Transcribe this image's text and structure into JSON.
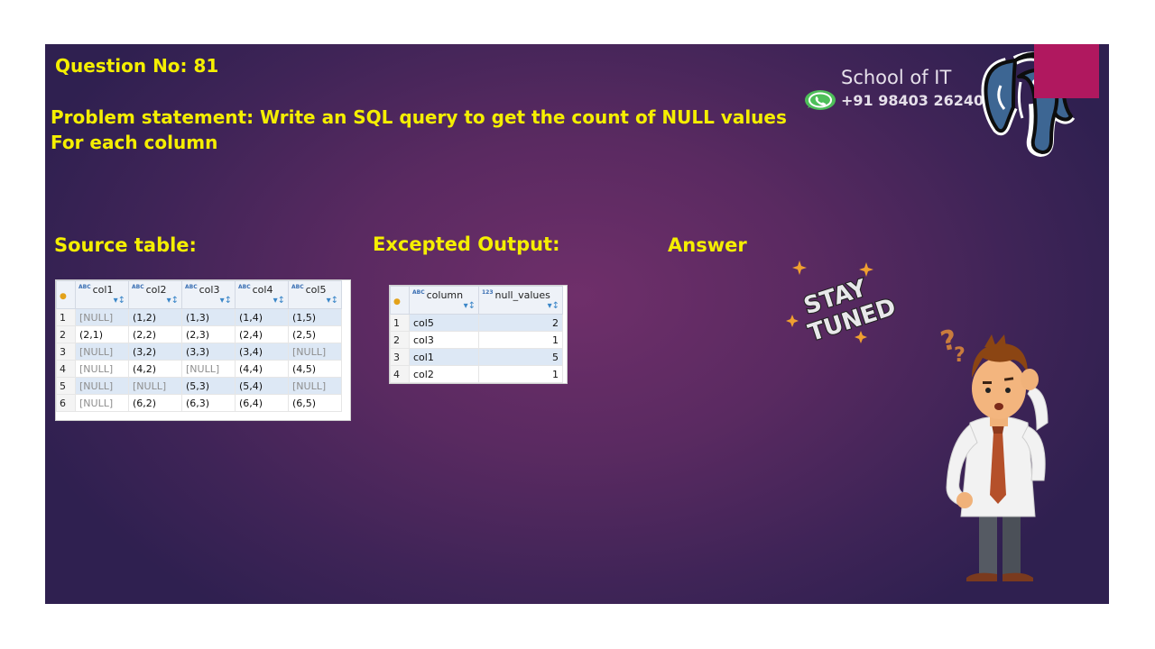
{
  "slide": {
    "question": "Question No: 81",
    "problem_line1": "Problem statement:  Write an SQL query to get the count of NULL values",
    "problem_line2": "For each column",
    "source_label": "Source table:",
    "output_label": "Excepted Output:",
    "answer_label": "Answer",
    "brand": "School of IT",
    "phone": "+91 98403 26240",
    "sticker_text": "STAY TUNED"
  },
  "colors": {
    "accent_yellow": "#f5ef00",
    "ribbon": "#b0185f",
    "bg": "#5a2a61"
  },
  "icons": [
    "whatsapp-icon",
    "postgresql-elephant-logo",
    "stay-tuned-sticker",
    "confused-man-illustration"
  ],
  "source_table": {
    "columns": [
      "col1",
      "col2",
      "col3",
      "col4",
      "col5"
    ],
    "type_tag": "ABC",
    "rows": [
      [
        "1",
        "[NULL]",
        "(1,2)",
        "(1,3)",
        "(1,4)",
        "(1,5)"
      ],
      [
        "2",
        "(2,1)",
        "(2,2)",
        "(2,3)",
        "(2,4)",
        "(2,5)"
      ],
      [
        "3",
        "[NULL]",
        "(3,2)",
        "(3,3)",
        "(3,4)",
        "[NULL]"
      ],
      [
        "4",
        "[NULL]",
        "(4,2)",
        "[NULL]",
        "(4,4)",
        "(4,5)"
      ],
      [
        "5",
        "[NULL]",
        "[NULL]",
        "(5,3)",
        "(5,4)",
        "[NULL]"
      ],
      [
        "6",
        "[NULL]",
        "(6,2)",
        "(6,3)",
        "(6,4)",
        "(6,5)"
      ]
    ]
  },
  "output_table": {
    "columns": [
      "column",
      "null_values"
    ],
    "type_tags": [
      "ABC",
      "123"
    ],
    "rows": [
      [
        "1",
        "col5",
        "2"
      ],
      [
        "2",
        "col3",
        "1"
      ],
      [
        "3",
        "col1",
        "5"
      ],
      [
        "4",
        "col2",
        "1"
      ]
    ]
  }
}
